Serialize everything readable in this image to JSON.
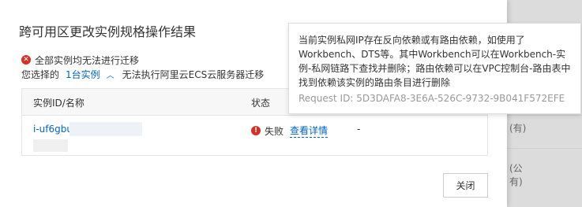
{
  "dialog": {
    "title": "跨可用区更改实例规格操作结果",
    "summary": "全部实例均无法进行迁移",
    "selected_prefix": "您选择的",
    "selected_count": "1台实例",
    "selected_note": "无法执行阿里云ECS云服务器迁移",
    "table": {
      "headers": [
        "实例ID/名称",
        "状态"
      ],
      "rows": [
        {
          "instance_id": "i-uf6gbu",
          "status": "失败",
          "detail_link": "查看详情",
          "extra": "-"
        }
      ]
    },
    "close_label": "关闭"
  },
  "tooltip": {
    "message": "当前实例私网IP存在反向依赖或有路由依赖，如使用了Workbench、DTS等。其中Workbench可以在Workbench-实例-私网链路下查找并删除；路由依赖可以在VPC控制台-路由表中找到依赖该实例的路由条目进行删除",
    "request_id": "Request ID: 5D3DAFA8-3E6A-526C-9732-9B041F572EFE"
  },
  "background": {
    "labels": [
      "(有)",
      "(公",
      "有)"
    ]
  },
  "colors": {
    "link": "#0064c8",
    "error": "#d93026"
  }
}
